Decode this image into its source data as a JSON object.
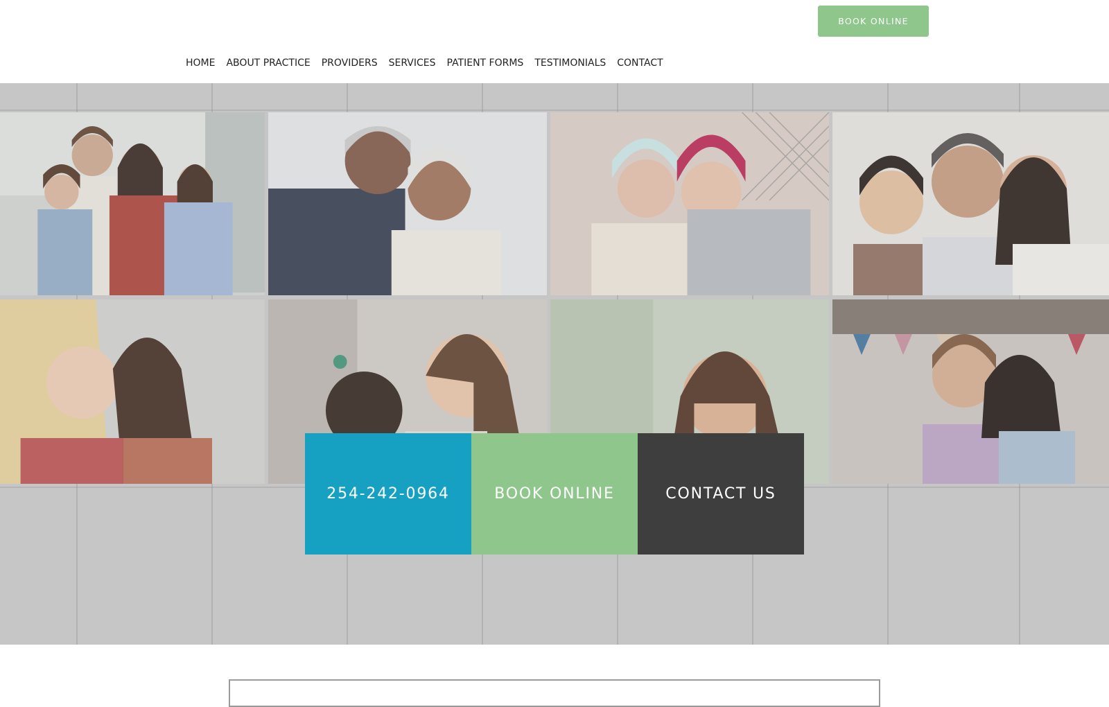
{
  "header": {
    "book_button_label": "BOOK ONLINE"
  },
  "nav": {
    "items": [
      {
        "label": "HOME"
      },
      {
        "label": "ABOUT PRACTICE"
      },
      {
        "label": "PROVIDERS"
      },
      {
        "label": "SERVICES"
      },
      {
        "label": "PATIENT FORMS"
      },
      {
        "label": "TESTIMONIALS"
      },
      {
        "label": "CONTACT"
      }
    ]
  },
  "hero": {
    "photos": [
      {
        "subject": "family-photo"
      },
      {
        "subject": "senior-couple-photo"
      },
      {
        "subject": "friends-in-beanies-photo"
      },
      {
        "subject": "father-son-mother-photo"
      },
      {
        "subject": "two-women-photo"
      },
      {
        "subject": "mother-daughter-photo"
      },
      {
        "subject": "smiling-woman-photo"
      },
      {
        "subject": "couple-outdoors-photo"
      }
    ]
  },
  "cta": {
    "phone": "254-242-0964",
    "book": "BOOK ONLINE",
    "contact": "CONTACT US"
  },
  "colors": {
    "accent_green": "#8ec68b",
    "accent_blue": "#16a0c2",
    "dark": "#3e3e3e",
    "nav_text": "#222222",
    "hero_bg": "#c6c6c6"
  }
}
